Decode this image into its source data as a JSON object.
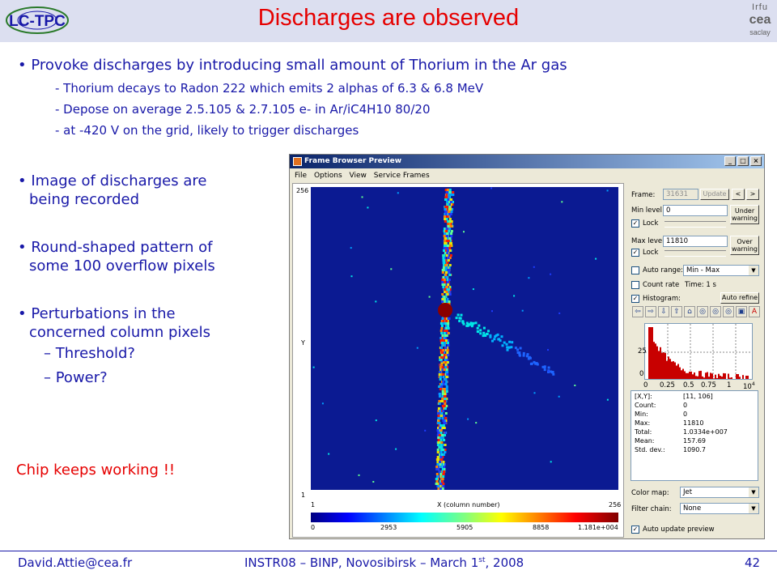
{
  "slide": {
    "title": "Discharges are observed",
    "logo_left_text": "LC-TPC",
    "logo_right": {
      "line1": "Irfu",
      "line2": "cea",
      "line3": "saclay"
    },
    "main_bullet": "Provoke discharges by introducing small amount of Thorium in the Ar gas",
    "sub_bullets": [
      "- Thorium decays to Radon 222 which emits 2 alphas of 6.3 & 6.8 MeV",
      "- Depose on average 2.5.105 & 2.7.105 e- in Ar/iC4H10 80/20",
      "- at -420 V on the grid, likely to trigger discharges"
    ],
    "left_bullets": [
      {
        "line1": "Image of discharges are",
        "line2": "being recorded"
      },
      {
        "line1": "Round-shaped pattern of",
        "line2": "some 100 overflow pixels"
      },
      {
        "line1": "Perturbations in the",
        "line2": "concerned column pixels"
      }
    ],
    "dash_items": [
      "– Threshold?",
      "– Power?"
    ],
    "highlight": "Chip keeps working !!",
    "bullet_glyph": "•"
  },
  "footer": {
    "email": "David.Attie@cea.fr",
    "event": "INSTR08 – BINP, Novosibirsk – March 1",
    "event_sup": "st",
    "event_year": ", 2008",
    "page": "42"
  },
  "window": {
    "title": "Frame Browser Preview",
    "buttons": [
      "_",
      "□",
      "×"
    ],
    "menu": [
      "File",
      "Options",
      "View",
      "Service Frames"
    ]
  },
  "plot": {
    "y_top": "256",
    "y_mid": "Y",
    "y_bottom": "1",
    "x_left": "1",
    "x_label": "X (column number)",
    "x_right": "256",
    "colorbar_ticks": [
      "0",
      "2953",
      "5905",
      "8858",
      "1.181e+004"
    ],
    "colormap": "jet",
    "track_direction": "diagonal"
  },
  "panel": {
    "frame_label": "Frame:",
    "frame_value": "31631",
    "update": "Update",
    "prev": "<",
    "next": ">",
    "min_level_label": "Min level:",
    "min_level_value": "0",
    "under_warning": {
      "line1": "Under",
      "line2": "warning"
    },
    "lock": "Lock",
    "max_level_label": "Max level:",
    "max_level_value": "11810",
    "over_warning": {
      "line1": "Over",
      "line2": "warning"
    },
    "auto_range": "Auto range:",
    "auto_range_value": "Min - Max",
    "count_rate": "Count rate",
    "time": "Time: 1 s",
    "histogram": "Histogram:",
    "auto_refine": "Auto refine",
    "check_mark": "✓",
    "select_arrow": "▼",
    "tools": [
      "⇦",
      "⇨",
      "⇩",
      "⇧",
      "⌂",
      "◎",
      "◎",
      "◎",
      "▣",
      "A"
    ],
    "hist_y_25": "25",
    "hist_y_0": "0",
    "hist_x": [
      "0",
      "0.25",
      "0.5",
      "0.75",
      "1",
      "10"
    ],
    "hist_x_exp": "4",
    "stats": [
      {
        "k": "[X,Y]:",
        "v": "[11, 106]"
      },
      {
        "k": "Count:",
        "v": "0"
      },
      {
        "k": "Min:",
        "v": "0"
      },
      {
        "k": "Max:",
        "v": "11810"
      },
      {
        "k": "Total:",
        "v": "1.0334e+007"
      },
      {
        "k": "Mean:",
        "v": "157.69"
      },
      {
        "k": "Std. dev.:",
        "v": "1090.7"
      }
    ],
    "color_map_label": "Color map:",
    "color_map_value": "Jet",
    "filter_chain_label": "Filter chain:",
    "filter_chain_value": "None",
    "auto_update": "Auto update preview"
  },
  "colors": {
    "title_red": "#e60000",
    "body_blue": "#1818a8",
    "header_bg": "#dcdff0",
    "plot_bg": "#0b1a92",
    "hist_red": "#c80000"
  }
}
